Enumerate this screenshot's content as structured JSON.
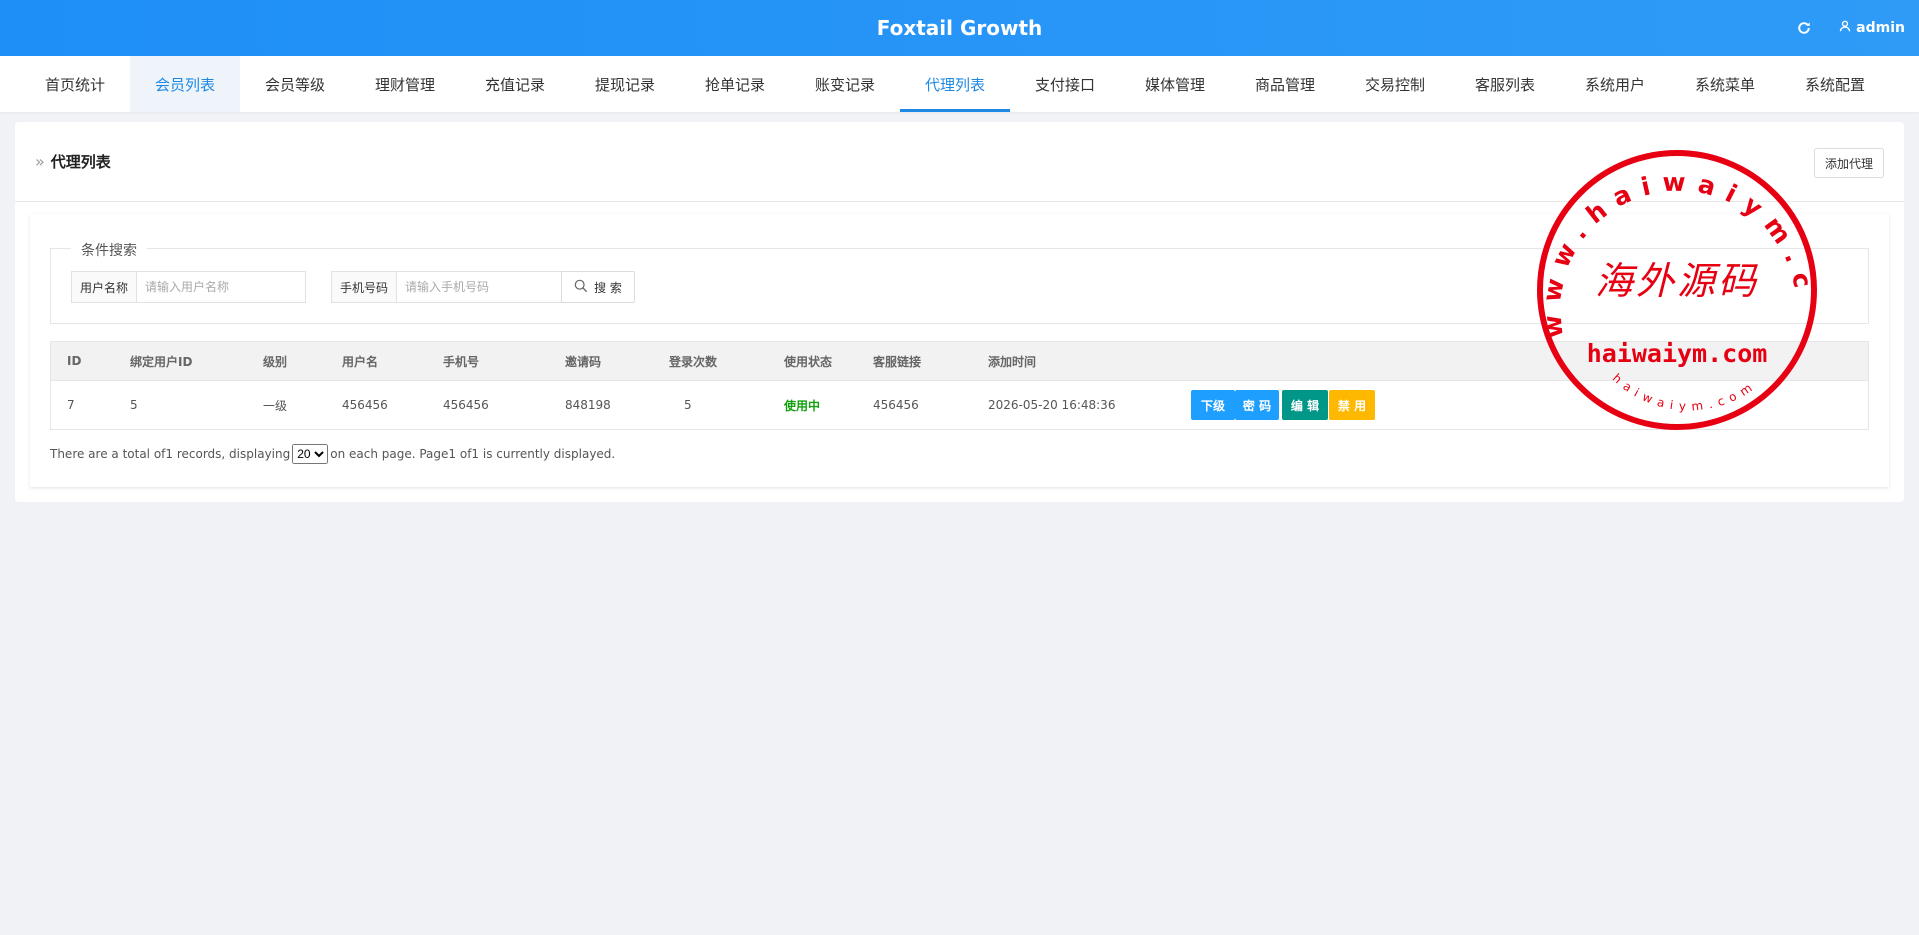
{
  "app": {
    "title": "Foxtail Growth",
    "refresh_icon": "refresh-icon",
    "user_icon": "user-icon",
    "user": "admin"
  },
  "nav": [
    {
      "label": "首页统计",
      "state": ""
    },
    {
      "label": "会员列表",
      "state": "hover"
    },
    {
      "label": "会员等级",
      "state": ""
    },
    {
      "label": "理财管理",
      "state": ""
    },
    {
      "label": "充值记录",
      "state": ""
    },
    {
      "label": "提现记录",
      "state": ""
    },
    {
      "label": "抢单记录",
      "state": ""
    },
    {
      "label": "账变记录",
      "state": ""
    },
    {
      "label": "代理列表",
      "state": "active"
    },
    {
      "label": "支付接口",
      "state": ""
    },
    {
      "label": "媒体管理",
      "state": ""
    },
    {
      "label": "商品管理",
      "state": ""
    },
    {
      "label": "交易控制",
      "state": ""
    },
    {
      "label": "客服列表",
      "state": ""
    },
    {
      "label": "系统用户",
      "state": ""
    },
    {
      "label": "系统菜单",
      "state": ""
    },
    {
      "label": "系统配置",
      "state": ""
    }
  ],
  "page": {
    "crumb": "»",
    "title": "代理列表",
    "add_button": "添加代理"
  },
  "search": {
    "legend": "条件搜索",
    "username_label": "用户名称",
    "username_placeholder": "请输入用户名称",
    "username_value": "",
    "phone_label": "手机号码",
    "phone_placeholder": "请输入手机号码",
    "phone_value": "",
    "button": "搜 索"
  },
  "table": {
    "headers": [
      "ID",
      "绑定用户ID",
      "级别",
      "用户名",
      "手机号",
      "邀请码",
      "登录次数",
      "使用状态",
      "客服链接",
      "添加时间"
    ],
    "rows": [
      {
        "id": "7",
        "bind_user_id": "5",
        "level": "一级",
        "username": "456456",
        "phone": "456456",
        "invite_code": "848198",
        "login_count": "5",
        "status": "使用中",
        "service_link": "456456",
        "added_time": "2026-05-20 16:48:36",
        "actions": {
          "sub": "下级",
          "password": "密 码",
          "edit": "编 辑",
          "disable": "禁 用"
        }
      }
    ]
  },
  "pager": {
    "prefix": "There are a total of1 records, displaying",
    "per_page": "20",
    "suffix": "on each page. Page1 of1 is currently displayed."
  },
  "watermark": {
    "ring_text": "www.haiwaiym.com",
    "center_text": "海外源码",
    "bottom_text": "haiwaiym.com",
    "small_text": "haiwaiym.com",
    "color": "#e60012"
  },
  "colors": {
    "brand": "#1e8ff7",
    "active_nav": "#1e88e5",
    "btn_blue": "#1e9fff",
    "btn_teal": "#009688",
    "btn_yellow": "#ffb800",
    "status_green": "#13a10e"
  }
}
